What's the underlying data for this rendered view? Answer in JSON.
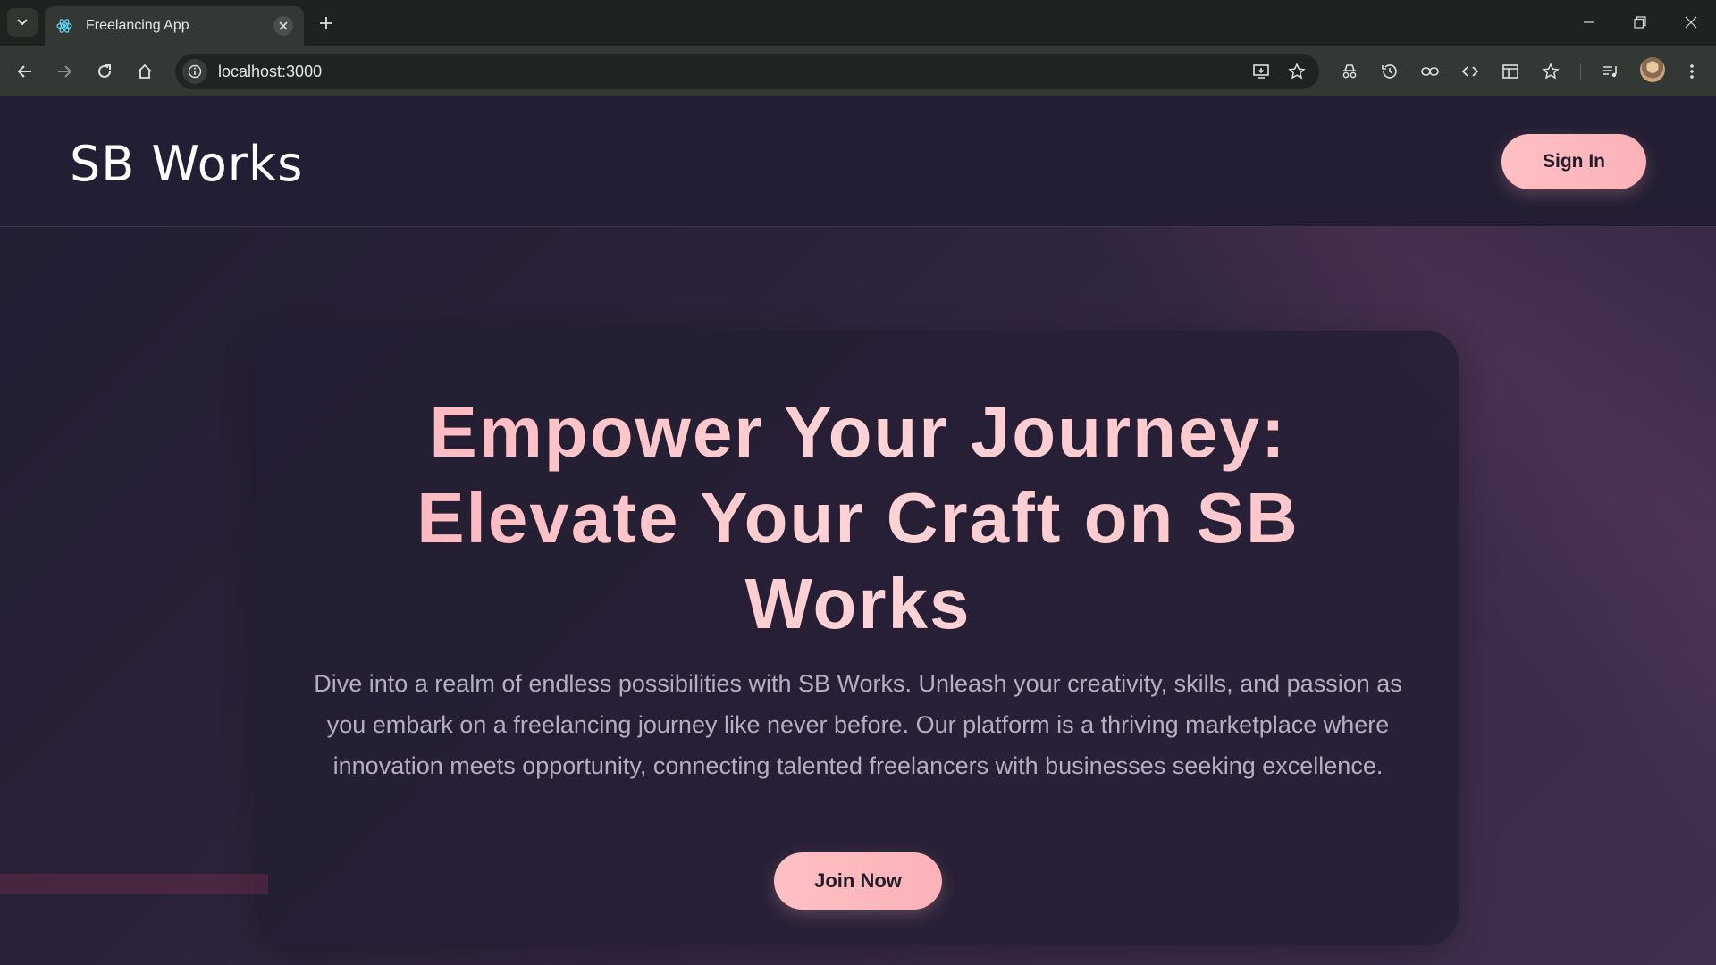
{
  "browser": {
    "tab_title": "Freelancing App",
    "url": "localhost:3000",
    "icons": [
      "tab-search-icon",
      "react-favicon-icon",
      "close-icon",
      "plus-icon",
      "minimize-icon",
      "restore-icon",
      "window-close-icon",
      "back-icon",
      "forward-icon",
      "reload-icon",
      "home-icon",
      "info-icon",
      "install-icon",
      "star-icon",
      "incognito-icon",
      "history-icon",
      "link-icon",
      "code-icon",
      "sidebar-icon",
      "bookmark-star-icon",
      "media-icon",
      "menu-icon"
    ]
  },
  "navbar": {
    "brand": "SB Works",
    "signin_label": "Sign In"
  },
  "hero": {
    "title_line1": "Empower Your Journey:",
    "title_line2": "Elevate Your Craft on SB",
    "title_line3": "Works",
    "text_line1": "Dive into a realm of endless possibilities with SB Works. Unleash your creativity, skills, and passion as",
    "text_line2": "you embark on a freelancing journey like never before. Our platform is a thriving marketplace where",
    "text_line3": "innovation meets opportunity, connecting talented freelancers with businesses seeking excellence.",
    "join_label": "Join Now"
  },
  "colors": {
    "accent": "#ffc0c4",
    "page_bg": "#231e33",
    "text_muted": "#b7afbd"
  }
}
